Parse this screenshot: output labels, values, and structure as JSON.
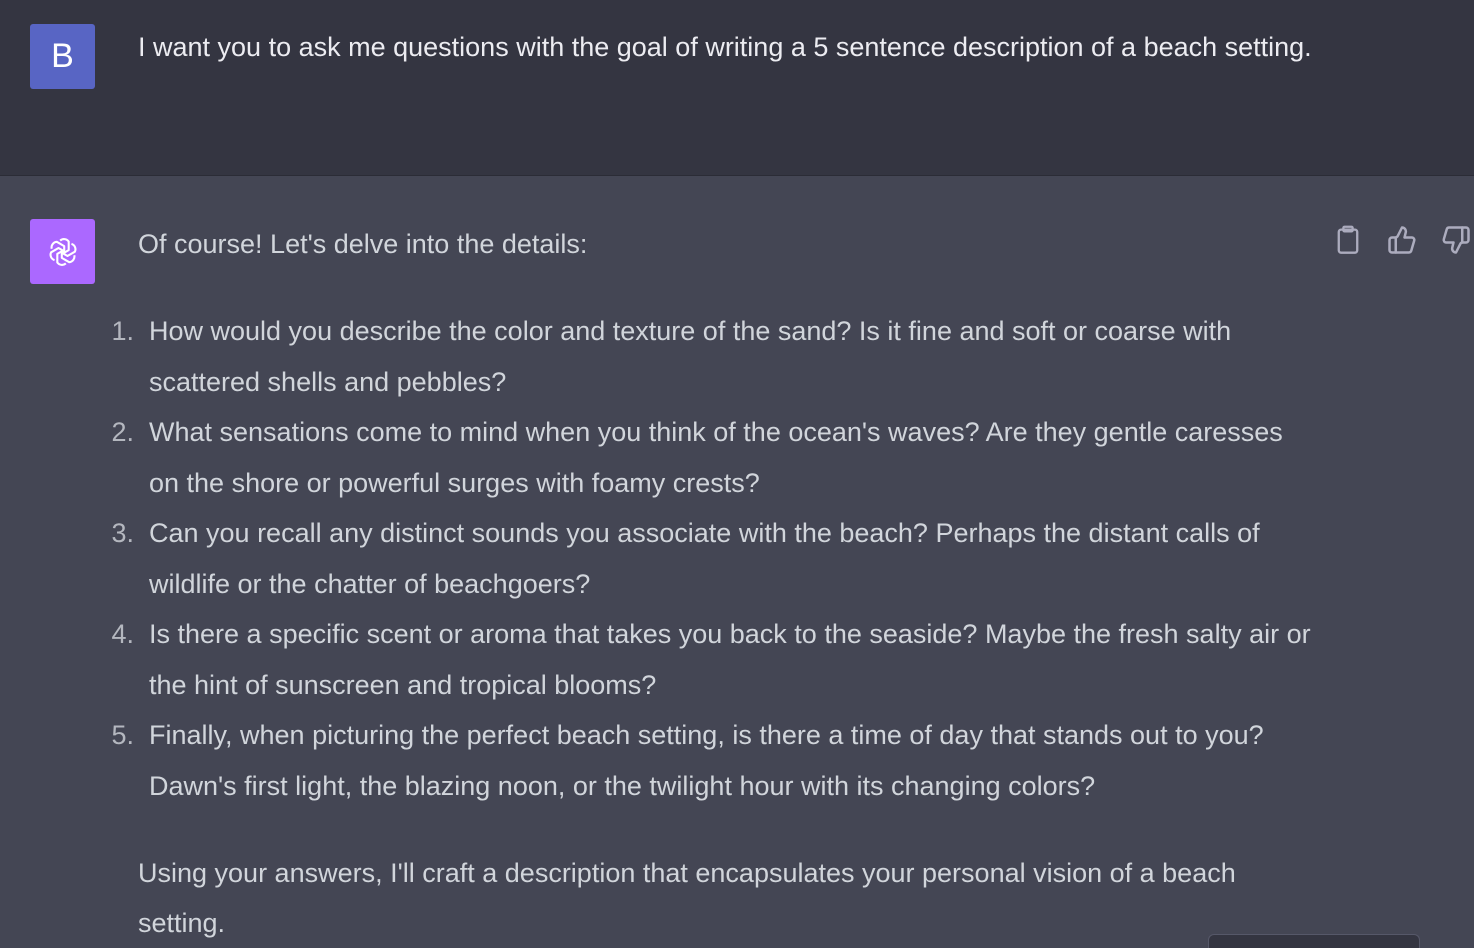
{
  "user_message": {
    "avatar_initial": "B",
    "text": "I want you to ask me questions with the goal of writing a 5 sentence description of a beach setting."
  },
  "assistant_message": {
    "avatar_icon": "openai-logo-icon",
    "intro": "Of course! Let's delve into the details:",
    "questions": [
      {
        "num": "1.",
        "text": "How would you describe the color and texture of the sand? Is it fine and soft or coarse with scattered shells and pebbles?"
      },
      {
        "num": "2.",
        "text": "What sensations come to mind when you think of the ocean's waves? Are they gentle caresses on the shore or powerful surges with foamy crests?"
      },
      {
        "num": "3.",
        "text": "Can you recall any distinct sounds you associate with the beach? Perhaps the distant calls of wildlife or the chatter of beachgoers?"
      },
      {
        "num": "4.",
        "text": "Is there a specific scent or aroma that takes you back to the seaside? Maybe the fresh salty air or the hint of sunscreen and tropical blooms?"
      },
      {
        "num": "5.",
        "text": "Finally, when picturing the perfect beach setting, is there a time of day that stands out to you? Dawn's first light, the blazing noon, or the twilight hour with its changing colors?"
      }
    ],
    "closing": "Using your answers, I'll craft a description that encapsulates your personal vision of a beach setting."
  },
  "actions": {
    "icons": [
      "clipboard-icon",
      "thumbs-up-icon",
      "thumbs-down-icon"
    ]
  },
  "colors": {
    "user_bg": "#343541",
    "assistant_bg": "#444654",
    "user_avatar": "#5865c4",
    "bot_avatar": "#ab68ff"
  }
}
